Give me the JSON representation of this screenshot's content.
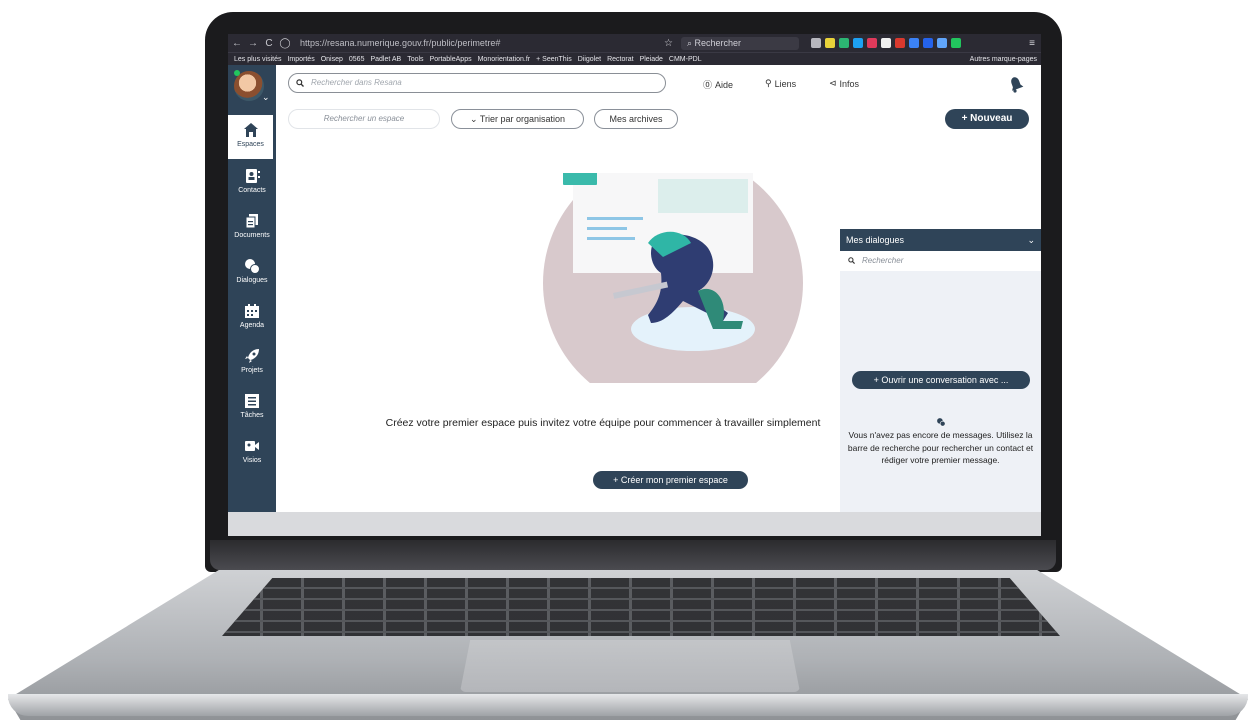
{
  "browser": {
    "url": "https://resana.numerique.gouv.fr/public/perimetre#",
    "search_placeholder": "Rechercher",
    "bookmarks": [
      "Les plus visités",
      "Importés",
      "Onisep",
      "0565",
      "Padlet AB",
      "Tools",
      "PortableApps",
      "Monorientation.fr",
      "+ SeenThis",
      "Diigolet",
      "Rectorat",
      "Pleiade",
      "CMM-PDL"
    ],
    "bookmarks_more": "Autres marque-pages"
  },
  "topbar": {
    "search_placeholder": "Rechercher dans Resana",
    "help_label": "Aide",
    "links_label": "Liens",
    "infos_label": "Infos"
  },
  "sidebar": {
    "items": [
      {
        "label": "Espaces"
      },
      {
        "label": "Contacts"
      },
      {
        "label": "Documents"
      },
      {
        "label": "Dialogues"
      },
      {
        "label": "Agenda"
      },
      {
        "label": "Projets"
      },
      {
        "label": "Tâches"
      },
      {
        "label": "Visios"
      }
    ]
  },
  "toolbar": {
    "space_search_placeholder": "Rechercher un espace",
    "sort_label": "Trier par organisation",
    "archives_label": "Mes archives",
    "new_label": "+ Nouveau"
  },
  "main": {
    "empty_text": "Créez votre premier espace puis invitez votre équipe pour commencer à travailler simplement",
    "create_label": "+ Créer mon premier espace"
  },
  "dialogs": {
    "title": "Mes dialogues",
    "search_placeholder": "Rechercher",
    "open_conversation_label": "+ Ouvrir une conversation avec ...",
    "no_messages_text": "Vous n'avez pas encore de messages. Utilisez la barre de recherche pour rechercher un contact et rédiger votre premier message."
  },
  "colors": {
    "brand": "#2f4458",
    "panel_bg": "#eef1f6",
    "illustration_circle": "#d8c9cc",
    "illustration_accent": "#2fb6a6"
  }
}
